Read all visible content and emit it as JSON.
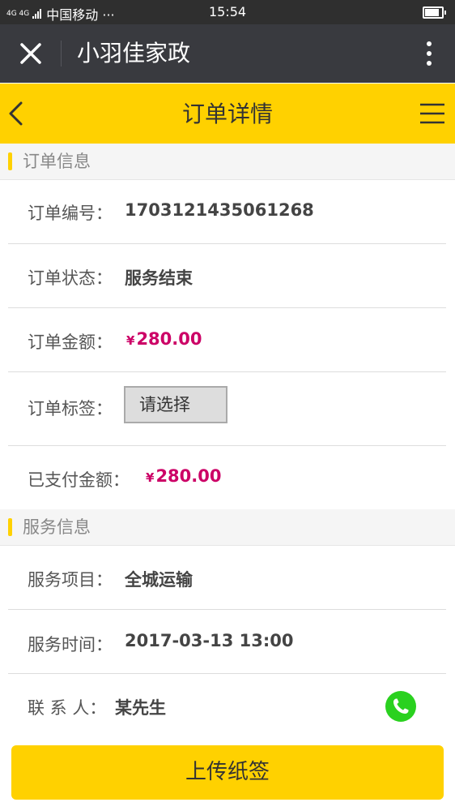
{
  "status_bar": {
    "network": "4G 4G",
    "carrier": "中国移动 ···",
    "time": "15:54",
    "battery_level": 0.9
  },
  "wechat_bar": {
    "title": "小羽佳家政",
    "close_icon": "close-icon",
    "more_icon": "more-vertical-icon"
  },
  "header": {
    "title": "订单详情",
    "back_icon": "chevron-left-icon",
    "menu_icon": "hamburger-menu-icon",
    "color": "#ffd100"
  },
  "order_info": {
    "section_title": "订单信息",
    "order_number_label": "订单编号：",
    "order_number": "1703121435061268",
    "status_label": "订单状态：",
    "status": "服务结束",
    "amount_label": "订单金额：",
    "currency": "¥",
    "amount": "280.00",
    "tag_label": "订单标签：",
    "tag_select": "请选择",
    "paid_label": "已支付金额：",
    "paid_amount": "280.00",
    "price_color": "#cc0066"
  },
  "service_info": {
    "section_title": "服务信息",
    "item_label": "服务项目：",
    "item": "全城运输",
    "time_label": "服务时间：",
    "time": "2017-03-13 13:00",
    "contact_label": "联 系 人：",
    "contact": "某先生",
    "phone_icon": "phone-call-icon",
    "phone_color": "#2ad11f"
  },
  "bottom": {
    "upload_label": "上传纸签"
  }
}
